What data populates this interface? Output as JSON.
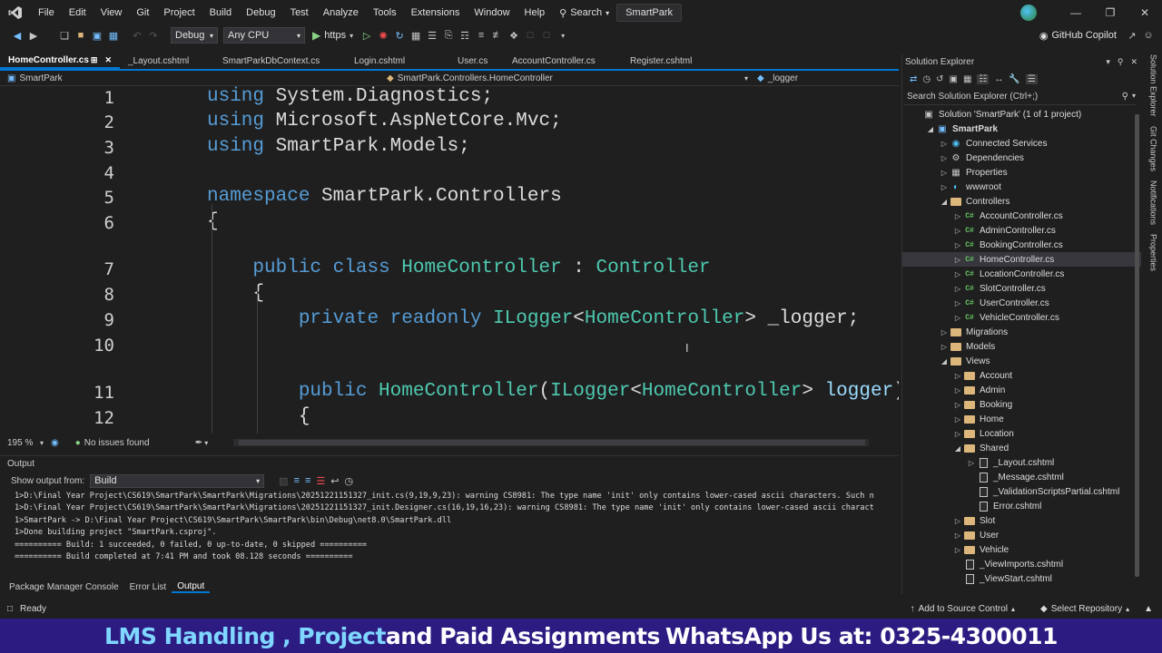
{
  "menu": [
    "File",
    "Edit",
    "View",
    "Git",
    "Project",
    "Build",
    "Debug",
    "Test",
    "Analyze",
    "Tools",
    "Extensions",
    "Window",
    "Help"
  ],
  "search_label": "Search",
  "project_name": "SmartPark",
  "toolbar": {
    "config": "Debug",
    "platform": "Any CPU",
    "run_target": "https",
    "copilot": "GitHub Copilot"
  },
  "tabs": [
    "HomeController.cs",
    "_Layout.cshtml",
    "SmartParkDbContext.cs",
    "Login.cshtml",
    "User.cs",
    "AccountController.cs",
    "Register.cshtml"
  ],
  "nav": {
    "project": "SmartPark",
    "class": "SmartPark.Controllers.HomeController",
    "member": "_logger"
  },
  "code_lines": [
    {
      "num": "1",
      "tokens": [
        [
          "kw",
          "using "
        ],
        [
          "nm",
          "System.Diagnostics;"
        ]
      ]
    },
    {
      "num": "2",
      "tokens": [
        [
          "kw",
          "using "
        ],
        [
          "nm",
          "Microsoft.AspNetCore.Mvc;"
        ]
      ]
    },
    {
      "num": "3",
      "tokens": [
        [
          "kw",
          "using "
        ],
        [
          "nm",
          "SmartPark.Models;"
        ]
      ]
    },
    {
      "num": "4",
      "tokens": []
    },
    {
      "num": "5",
      "tokens": [
        [
          "kw",
          "namespace "
        ],
        [
          "nm",
          "SmartPark.Controllers"
        ]
      ]
    },
    {
      "num": "6",
      "tokens": [
        [
          "nm",
          "{"
        ]
      ]
    },
    {
      "num": "7",
      "tokens": [
        [
          "nm",
          "    "
        ],
        [
          "kw",
          "public class "
        ],
        [
          "ty",
          "HomeController"
        ],
        [
          "nm",
          " : "
        ],
        [
          "ty",
          "Controller"
        ]
      ]
    },
    {
      "num": "8",
      "tokens": [
        [
          "nm",
          "    {"
        ]
      ]
    },
    {
      "num": "9",
      "tokens": [
        [
          "nm",
          "        "
        ],
        [
          "kw",
          "private readonly "
        ],
        [
          "ty",
          "ILogger"
        ],
        [
          "nm",
          "<"
        ],
        [
          "ty",
          "HomeController"
        ],
        [
          "nm",
          "> _logger;"
        ]
      ]
    },
    {
      "num": "10",
      "tokens": []
    },
    {
      "num": "11",
      "tokens": [
        [
          "nm",
          "        "
        ],
        [
          "kw",
          "public "
        ],
        [
          "ty",
          "HomeController"
        ],
        [
          "nm",
          "("
        ],
        [
          "ty",
          "ILogger"
        ],
        [
          "nm",
          "<"
        ],
        [
          "ty",
          "HomeController"
        ],
        [
          "nm",
          "> "
        ],
        [
          "id",
          "logger"
        ],
        [
          "nm",
          ")"
        ]
      ]
    },
    {
      "num": "12",
      "tokens": [
        [
          "nm",
          "        {"
        ]
      ]
    }
  ],
  "editor_status": {
    "zoom": "195 %",
    "issues": "No issues found"
  },
  "output": {
    "title": "Output",
    "show_from_label": "Show output from:",
    "source": "Build",
    "lines": [
      "1>D:\\Final Year Project\\CS619\\SmartPark\\SmartPark\\Migrations\\20251221151327_init.cs(9,19,9,23): warning CS8981: The type name 'init' only contains lower-cased ascii characters. Such n",
      "1>D:\\Final Year Project\\CS619\\SmartPark\\SmartPark\\Migrations\\20251221151327_init.Designer.cs(16,19,16,23): warning CS8981: The type name 'init' only contains lower-cased ascii charact",
      "1>SmartPark -> D:\\Final Year Project\\CS619\\SmartPark\\SmartPark\\bin\\Debug\\net8.0\\SmartPark.dll",
      "1>Done building project \"SmartPark.csproj\".",
      "========== Build: 1 succeeded, 0 failed, 0 up-to-date, 0 skipped ==========",
      "========== Build completed at 7:41 PM and took 08.128 seconds =========="
    ]
  },
  "bottom_tabs": [
    "Package Manager Console",
    "Error List",
    "Output"
  ],
  "solution_explorer": {
    "title": "Solution Explorer",
    "search_placeholder": "Search Solution Explorer (Ctrl+;)",
    "items": [
      {
        "label": "Solution 'SmartPark' (1 of 1 project)",
        "indent": 0,
        "arrow": "",
        "icon": "solution"
      },
      {
        "label": "SmartPark",
        "indent": 1,
        "arrow": "down",
        "icon": "project",
        "bold": true
      },
      {
        "label": "Connected Services",
        "indent": 2,
        "arrow": "right",
        "icon": "connected"
      },
      {
        "label": "Dependencies",
        "indent": 2,
        "arrow": "right",
        "icon": "deps"
      },
      {
        "label": "Properties",
        "indent": 2,
        "arrow": "right",
        "icon": "props"
      },
      {
        "label": "wwwroot",
        "indent": 2,
        "arrow": "right",
        "icon": "globe"
      },
      {
        "label": "Controllers",
        "indent": 2,
        "arrow": "down",
        "icon": "folder"
      },
      {
        "label": "AccountController.cs",
        "indent": 3,
        "arrow": "right",
        "icon": "cs"
      },
      {
        "label": "AdminController.cs",
        "indent": 3,
        "arrow": "right",
        "icon": "cs"
      },
      {
        "label": "BookingController.cs",
        "indent": 3,
        "arrow": "right",
        "icon": "cs"
      },
      {
        "label": "HomeController.cs",
        "indent": 3,
        "arrow": "right",
        "icon": "cs",
        "selected": true
      },
      {
        "label": "LocationController.cs",
        "indent": 3,
        "arrow": "right",
        "icon": "cs"
      },
      {
        "label": "SlotController.cs",
        "indent": 3,
        "arrow": "right",
        "icon": "cs"
      },
      {
        "label": "UserController.cs",
        "indent": 3,
        "arrow": "right",
        "icon": "cs"
      },
      {
        "label": "VehicleController.cs",
        "indent": 3,
        "arrow": "right",
        "icon": "cs"
      },
      {
        "label": "Migrations",
        "indent": 2,
        "arrow": "right",
        "icon": "folder"
      },
      {
        "label": "Models",
        "indent": 2,
        "arrow": "right",
        "icon": "folder"
      },
      {
        "label": "Views",
        "indent": 2,
        "arrow": "down",
        "icon": "folder"
      },
      {
        "label": "Account",
        "indent": 3,
        "arrow": "right",
        "icon": "folder"
      },
      {
        "label": "Admin",
        "indent": 3,
        "arrow": "right",
        "icon": "folder"
      },
      {
        "label": "Booking",
        "indent": 3,
        "arrow": "right",
        "icon": "folder"
      },
      {
        "label": "Home",
        "indent": 3,
        "arrow": "right",
        "icon": "folder"
      },
      {
        "label": "Location",
        "indent": 3,
        "arrow": "right",
        "icon": "folder"
      },
      {
        "label": "Shared",
        "indent": 3,
        "arrow": "down",
        "icon": "folder"
      },
      {
        "label": "_Layout.cshtml",
        "indent": 4,
        "arrow": "right",
        "icon": "cshtml"
      },
      {
        "label": "_Message.cshtml",
        "indent": 4,
        "arrow": "",
        "icon": "cshtml"
      },
      {
        "label": "_ValidationScriptsPartial.cshtml",
        "indent": 4,
        "arrow": "",
        "icon": "cshtml"
      },
      {
        "label": "Error.cshtml",
        "indent": 4,
        "arrow": "",
        "icon": "cshtml"
      },
      {
        "label": "Slot",
        "indent": 3,
        "arrow": "right",
        "icon": "folder"
      },
      {
        "label": "User",
        "indent": 3,
        "arrow": "right",
        "icon": "folder"
      },
      {
        "label": "Vehicle",
        "indent": 3,
        "arrow": "right",
        "icon": "folder"
      },
      {
        "label": "_ViewImports.cshtml",
        "indent": 3,
        "arrow": "",
        "icon": "cshtml"
      },
      {
        "label": "_ViewStart.cshtml",
        "indent": 3,
        "arrow": "",
        "icon": "cshtml"
      }
    ]
  },
  "side_rail": [
    "Solution Explorer",
    "Git Changes",
    "Notifications",
    "Properties"
  ],
  "statusbar": {
    "ready": "Ready",
    "source_control": "Add to Source Control",
    "repo": "Select Repository"
  },
  "banner": {
    "part1": "LMS Handling , Project ",
    "part2": "and Paid Assignments ",
    "part3": "WhatsApp Us at: 0325-4300011"
  },
  "colors": {
    "accent": "#0078d4",
    "banner_bg": "#2c1c82",
    "keyword": "#569cd6",
    "type": "#4ec9b0"
  }
}
